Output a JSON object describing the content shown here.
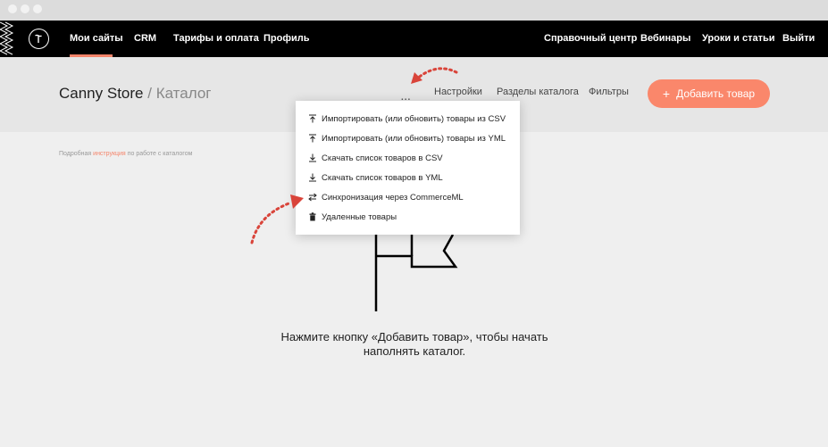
{
  "topnav": {
    "logo_letter": "T",
    "items": [
      {
        "label": "Мои сайты"
      },
      {
        "label": "CRM"
      },
      {
        "label": "Тарифы и оплата"
      },
      {
        "label": "Профиль"
      }
    ],
    "right_items": [
      {
        "label": "Справочный центр"
      },
      {
        "label": "Вебинары"
      },
      {
        "label": "Уроки и статьи"
      },
      {
        "label": "Выйти"
      }
    ]
  },
  "header": {
    "site_name": "Canny Store",
    "separator": "/",
    "page": "Каталог",
    "more_label": "...",
    "links": [
      {
        "label": "Настройки"
      },
      {
        "label": "Разделы каталога"
      },
      {
        "label": "Фильтры"
      }
    ],
    "add_button": {
      "icon": "+",
      "label": "Добавить товар"
    }
  },
  "help": {
    "prefix": "Подробная",
    "link": "инструкция",
    "suffix": "по работе с каталогом"
  },
  "dropdown": {
    "items": [
      {
        "icon": "upload-icon",
        "label": "Импортировать (или обновить) товары из CSV"
      },
      {
        "icon": "upload-icon",
        "label": "Импортировать (или обновить) товары из YML"
      },
      {
        "icon": "download-icon",
        "label": "Скачать список товаров в CSV"
      },
      {
        "icon": "download-icon",
        "label": "Скачать список товаров в YML"
      },
      {
        "icon": "sync-icon",
        "label": "Синхронизация через CommerceML"
      },
      {
        "icon": "trash-icon",
        "label": "Удаленные товары"
      }
    ]
  },
  "empty_state": {
    "line1": "Нажмите кнопку «Добавить товар», чтобы начать",
    "line2": "наполнять каталог."
  },
  "colors": {
    "accent": "#fa876b",
    "nav_bg": "#000000",
    "page_bg": "#efefef",
    "arrow": "#d9443a"
  }
}
